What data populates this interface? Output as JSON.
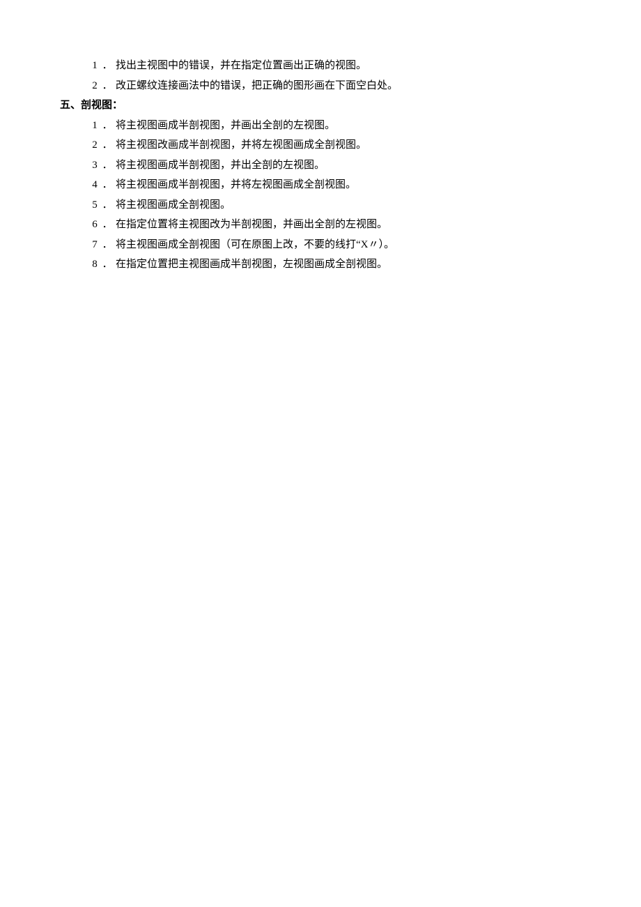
{
  "top_items": [
    {
      "num": "1",
      "text": "找出主视图中的错误，并在指定位置画出正确的视图。"
    },
    {
      "num": "2",
      "text": "改正螺纹连接画法中的错误，把正确的图形画在下面空白处。"
    }
  ],
  "section": {
    "label": "五、剖视图："
  },
  "sub_items": [
    {
      "num": "1",
      "text": "将主视图画成半剖视图，并画出全剖的左视图。"
    },
    {
      "num": "2",
      "text": "将主视图改画成半剖视图，并将左视图画成全剖视图。"
    },
    {
      "num": "3",
      "text": "将主视图画成半剖视图，并出全剖的左视图。"
    },
    {
      "num": "4",
      "text": "将主视图画成半剖视图，并将左视图画成全剖视图。"
    },
    {
      "num": "5",
      "text": "将主视图画成全剖视图。"
    },
    {
      "num": "6",
      "text": "在指定位置将主视图改为半剖视图，并画出全剖的左视图。"
    },
    {
      "num": "7",
      "text": "将主视图画成全剖视图（可在原图上改，不要的线打“X〃）。"
    },
    {
      "num": "8",
      "text": "在指定位置把主视图画成半剖视图，左视图画成全剖视图。"
    }
  ],
  "separator": "．"
}
